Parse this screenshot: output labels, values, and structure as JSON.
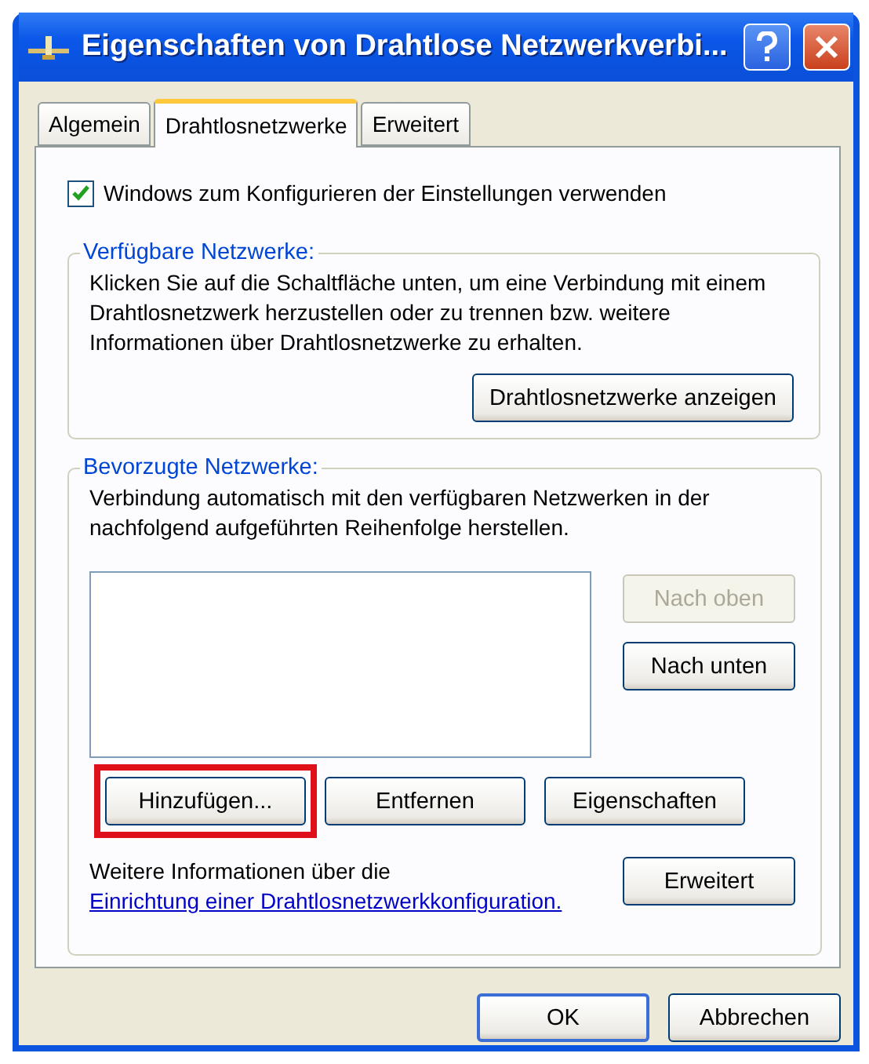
{
  "window": {
    "title": "Eigenschaften von Drahtlose Netzwerkverbi..."
  },
  "tabs": [
    {
      "label": "Algemein",
      "selected": false
    },
    {
      "label": "Drahtlosnetzwerke",
      "selected": true
    },
    {
      "label": "Erweitert",
      "selected": false
    }
  ],
  "use_windows_checkbox": {
    "label": "Windows zum Konfigurieren der Einstellungen verwenden",
    "checked": true
  },
  "available_networks": {
    "legend": "Verfügbare Netzwerke:",
    "description": "Klicken Sie auf die Schaltfläche unten, um eine Verbindung mit einem Drahtlosnetzwerk herzustellen oder zu trennen bzw. weitere Informationen über Drahtlosnetzwerke zu erhalten.",
    "button": "Drahtlosnetzwerke anzeigen"
  },
  "preferred_networks": {
    "legend": "Bevorzugte Netzwerke:",
    "description": "Verbindung automatisch mit den verfügbaren Netzwerken in der nachfolgend aufgeführten Reihenfolge herstellen.",
    "side_buttons": [
      {
        "label": "Nach oben",
        "disabled": true
      },
      {
        "label": "Nach unten",
        "disabled": false
      }
    ],
    "action_buttons": [
      {
        "label": "Hinzufügen...",
        "highlighted": true
      },
      {
        "label": "Entfernen",
        "highlighted": false
      },
      {
        "label": "Eigenschaften",
        "highlighted": false
      }
    ],
    "info_text": "Weitere Informationen über die",
    "info_link": "Einrichtung einer Drahtlosnetzwerkkonfiguration.",
    "advanced_button": "Erweitert"
  },
  "footer_buttons": [
    {
      "label": "OK",
      "default": true
    },
    {
      "label": "Abbrechen",
      "default": false
    }
  ]
}
